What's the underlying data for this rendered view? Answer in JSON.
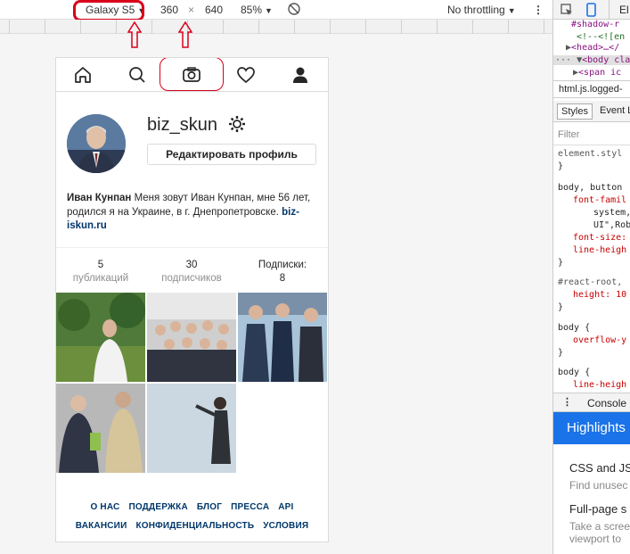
{
  "toolbar": {
    "device": "Galaxy S5",
    "width": "360",
    "times": "×",
    "height": "640",
    "zoom": "85%",
    "throttling": "No throttling"
  },
  "profile": {
    "username": "biz_skun",
    "edit_button": "Редактировать профиль",
    "bio_name": "Иван Кунпан",
    "bio_text": " Меня зовут Иван Кунпан, мне 56 лет, родился я на Украине, в г. Днепропетровске. ",
    "bio_link": "biz-iskun.ru",
    "stats": [
      {
        "num": "5",
        "label": "публикаций"
      },
      {
        "num": "30",
        "label": "подписчиков"
      },
      {
        "num": "Подписки:",
        "label": "8"
      }
    ]
  },
  "footer": {
    "links": [
      "О НАС",
      "ПОДДЕРЖКА",
      "БЛОГ",
      "ПРЕССА",
      "API",
      "ВАКАНСИИ",
      "КОНФИДЕНЦИАЛЬНОСТЬ",
      "УСЛОВИЯ"
    ]
  },
  "devtools": {
    "lines": [
      "#shadow-r",
      "<!--<![en",
      "<head>…</",
      "<body cla",
      "<span ic"
    ],
    "breadcrumb": "html.js.logged-",
    "tabs": [
      "Styles",
      "Event L"
    ],
    "filter": "Filter",
    "css": [
      "element.styl",
      "}",
      "body, button",
      "font-famil",
      "system,",
      "UI\",Rob",
      "font-size:",
      "line-heigh",
      "}",
      "#react-root,",
      "height: 10",
      "}",
      "body {",
      "overflow-y",
      "}",
      "body {",
      "line-heigh"
    ],
    "console": "Console",
    "highlights": "Highlights",
    "items": [
      "CSS and JS",
      "Find unusec",
      "Full-page s",
      "Take a scree",
      "viewport to"
    ],
    "el_tab": "El"
  },
  "colors": {
    "accent_red": "#d9001b",
    "devtools_blue": "#1a73e8",
    "link": "#00376b"
  }
}
